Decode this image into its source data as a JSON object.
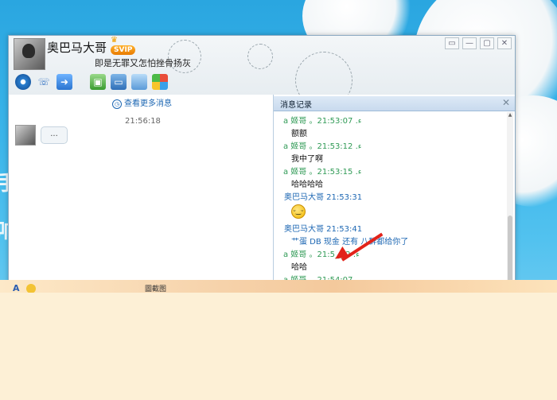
{
  "chat_window": {
    "contact_name": "奥巴马大哥",
    "vip_badge": "SVIP",
    "signature": "即是无罪又怎怕挫骨扬灰",
    "window_buttons": [
      "▭",
      "—",
      "▢",
      "✕"
    ],
    "toolbar_icons": [
      "video-call-icon",
      "voice-call-icon",
      "file-transfer-icon",
      "remote-desktop-icon",
      "screen-share-icon",
      "app-icon",
      "apps-grid-icon"
    ],
    "view_more_label": "查看更多消息",
    "time_divider": "21:56:18",
    "last_message": "..."
  },
  "history": {
    "title": "消息记录",
    "close_label": "✕",
    "messages": [
      {
        "sender": "a  姬哥  。21:53:07  .ء",
        "text": "额额",
        "type": "text"
      },
      {
        "sender": "a  姬哥  。21:53:12  .ء",
        "text": "我中了啊",
        "type": "text"
      },
      {
        "sender": "a  姬哥  。21:53:15  .ء",
        "text": "哈哈哈哈",
        "type": "text"
      },
      {
        "sender": "奥巴马大哥 21:53:31",
        "text": "",
        "type": "emoji"
      },
      {
        "sender": "奥巴马大哥 21:53:41",
        "text": "艹蛋  DB  现金  还有  八群都给你了",
        "type": "text"
      },
      {
        "sender": "a  姬哥  。21:5_:_2  .ء",
        "text": "哈哈",
        "type": "text"
      },
      {
        "sender": "a  姬哥  。21:54:07",
        "text": "",
        "type": "text"
      }
    ]
  },
  "desktop": {
    "edge_chars": [
      "手",
      "响"
    ]
  },
  "bottom_toolbar": {
    "font_icon_label": "A",
    "partial_text": "圖截图"
  },
  "colors": {
    "accent_blue": "#1d67b3",
    "sender_green": "#2f9a55",
    "arrow_red": "#e2231a"
  }
}
